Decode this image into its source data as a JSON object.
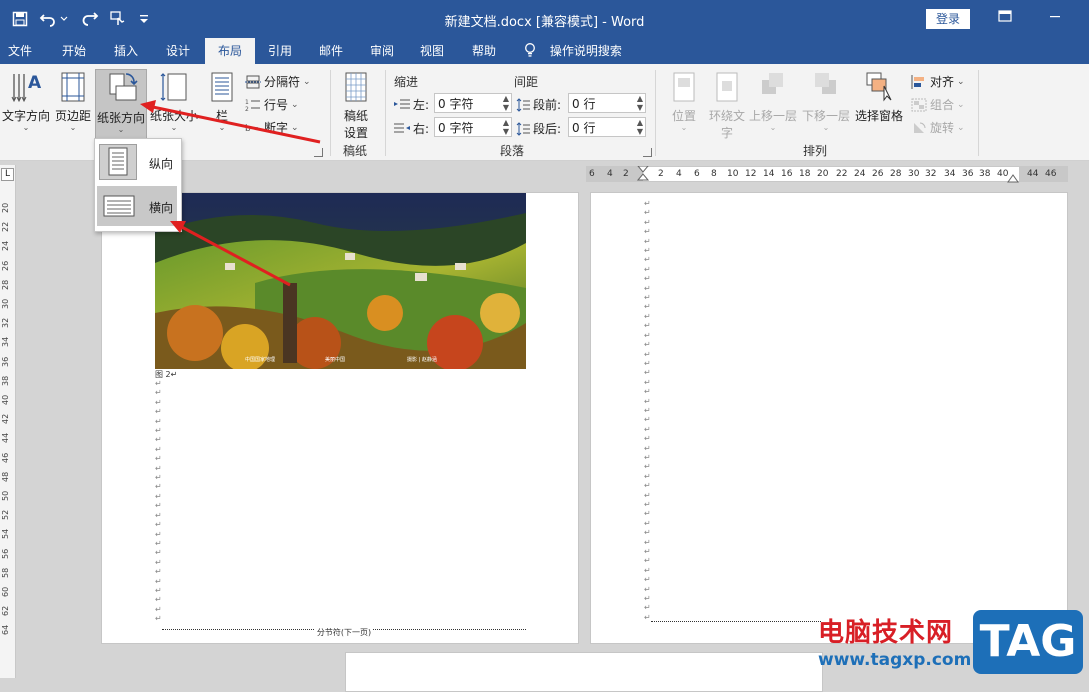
{
  "title_bar": {
    "document_title": "新建文档.docx [兼容模式]  -  Word",
    "login_label": "登录",
    "icons": [
      "save-icon",
      "undo-icon",
      "redo-icon",
      "touch-mode-icon",
      "customize-qat-icon",
      "ribbon-display-icon",
      "minimize-icon"
    ]
  },
  "tabs": [
    {
      "label": "文件"
    },
    {
      "label": "开始"
    },
    {
      "label": "插入"
    },
    {
      "label": "设计"
    },
    {
      "label": "布局",
      "active": true
    },
    {
      "label": "引用"
    },
    {
      "label": "邮件"
    },
    {
      "label": "审阅"
    },
    {
      "label": "视图"
    },
    {
      "label": "帮助"
    }
  ],
  "tell_me": "操作说明搜索",
  "ribbon": {
    "page_setup": {
      "text_direction": "文字方向",
      "margins": "页边距",
      "orientation": "纸张方向",
      "size": "纸张大小",
      "columns": "栏",
      "breaks": "分隔符",
      "line_numbers": "行号",
      "hyphenation": "断字"
    },
    "manuscript": {
      "button_line1": "稿纸",
      "button_line2": "设置",
      "group_label": "稿纸"
    },
    "paragraph": {
      "indent_header": "缩进",
      "spacing_header": "间距",
      "left_label": "左:",
      "left_value": "0 字符",
      "right_label": "右:",
      "right_value": "0 字符",
      "before_label": "段前:",
      "before_value": "0 行",
      "after_label": "段后:",
      "after_value": "0 行",
      "group_label": "段落"
    },
    "arrange": {
      "position": "位置",
      "wrap_line1": "环绕文",
      "wrap_line2": "字",
      "bring_forward": "上移一层",
      "send_backward": "下移一层",
      "selection_pane": "选择窗格",
      "align": "对齐",
      "group": "组合",
      "rotate": "旋转",
      "group_label": "排列"
    }
  },
  "orientation_menu": {
    "portrait": "纵向",
    "landscape": "横向",
    "highlighted": "横向"
  },
  "vertical_ruler_ticks": [
    "20",
    "22",
    "24",
    "26",
    "28",
    "30",
    "32",
    "34",
    "36",
    "38",
    "40",
    "42",
    "44",
    "46",
    "48",
    "50",
    "52",
    "54",
    "56",
    "58",
    "60",
    "62",
    "64"
  ],
  "horizontal_ruler_ticks": [
    "6",
    "4",
    "2",
    "2",
    "4",
    "6",
    "8",
    "10",
    "12",
    "14",
    "16",
    "18",
    "20",
    "22",
    "24",
    "26",
    "28",
    "30",
    "32",
    "34",
    "36",
    "38",
    "40",
    "44",
    "46"
  ],
  "document": {
    "figure_caption": "图 2↵",
    "section_break": "分节符(下一页)",
    "image_credits": [
      "中国国家地理",
      "美丽中国",
      "摄影 | 赵静涵"
    ]
  },
  "watermark": {
    "text": "电脑技术网",
    "url": "www.tagxp.com",
    "badge": "TAG"
  },
  "colors": {
    "title_bar": "#2b579a",
    "ribbon": "#f3f3f3",
    "annotation_arrow": "#e02020"
  }
}
